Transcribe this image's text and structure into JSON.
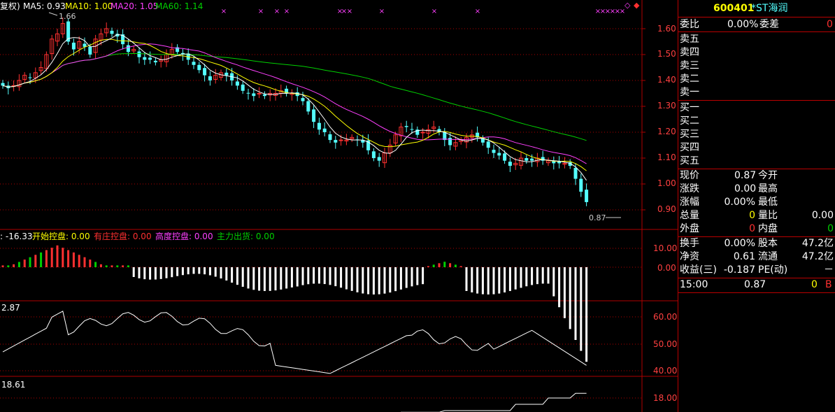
{
  "header": {
    "prefix": "复权)",
    "ma5": "MA5: 0.93",
    "ma10": "MA10: 1.00",
    "ma20": "MA20: 1.05",
    "ma60": "MA60: 1.14",
    "high_marker": "1.66",
    "low_marker": "0.87"
  },
  "ind1": {
    "prefix": ": -16.33",
    "items": [
      "开始控盘: 0.00",
      "有庄控盘: 0.00",
      "高度控盘: 0.00",
      "主力出货: 0.00"
    ]
  },
  "ind2": {
    "value": "2.87"
  },
  "ind3": {
    "value": "18.61"
  },
  "axes": {
    "price": [
      "1.60",
      "1.50",
      "1.40",
      "1.30",
      "1.20",
      "1.10",
      "1.00",
      "0.90"
    ],
    "ind1": [
      "10.00",
      "0.00"
    ],
    "ind2": [
      "60.00",
      "50.00",
      "40.00"
    ],
    "ind3": [
      "18.00"
    ]
  },
  "colors": {
    "up": "#ff3030",
    "down": "#54ffff",
    "ma5": "#ffffff",
    "ma10": "#ffff00",
    "ma20": "#ff40ff",
    "ma60": "#00d000",
    "grid": "#b00000"
  },
  "quote": {
    "code": "600401",
    "name": "*ST海润",
    "weibi_label": "委比",
    "weibi_value": "0.00%",
    "weicha_label": "委差",
    "weicha_value": "0",
    "sell": [
      "卖五",
      "卖四",
      "卖三",
      "卖二",
      "卖一"
    ],
    "buy": [
      "买一",
      "买二",
      "买三",
      "买四",
      "买五"
    ],
    "stats": [
      {
        "l1": "现价",
        "v1": "0.87",
        "l2": "今开",
        "v2": ""
      },
      {
        "l1": "涨跌",
        "v1": "0.00",
        "l2": "最高",
        "v2": ""
      },
      {
        "l1": "涨幅",
        "v1": "0.00%",
        "l2": "最低",
        "v2": ""
      },
      {
        "l1": "总量",
        "v1": "0",
        "l2": "量比",
        "v2": "0.00"
      },
      {
        "l1": "外盘",
        "v1": "0",
        "l2": "内盘",
        "v2": "0"
      }
    ],
    "fund": [
      {
        "l1": "换手",
        "v1": "0.00%",
        "l2": "股本",
        "v2": "47.2亿"
      },
      {
        "l1": "净资",
        "v1": "0.61",
        "l2": "流通",
        "v2": "47.2亿"
      },
      {
        "l1": "收益(三)",
        "v1": "-0.187",
        "l2": "PE(动)",
        "v2": "－"
      }
    ],
    "tick": {
      "time": "15:00",
      "price": "0.87",
      "vol": "0",
      "side": "B"
    }
  },
  "chart_data": {
    "type": "candlestick",
    "ylim": [
      0.85,
      1.66
    ],
    "closes": [
      1.38,
      1.37,
      1.38,
      1.4,
      1.42,
      1.41,
      1.43,
      1.45,
      1.5,
      1.56,
      1.58,
      1.62,
      1.55,
      1.52,
      1.55,
      1.53,
      1.5,
      1.56,
      1.58,
      1.6,
      1.58,
      1.57,
      1.54,
      1.51,
      1.52,
      1.49,
      1.48,
      1.48,
      1.47,
      1.48,
      1.5,
      1.52,
      1.51,
      1.5,
      1.48,
      1.46,
      1.44,
      1.42,
      1.4,
      1.42,
      1.43,
      1.42,
      1.4,
      1.38,
      1.36,
      1.35,
      1.34,
      1.35,
      1.34,
      1.35,
      1.35,
      1.36,
      1.35,
      1.35,
      1.34,
      1.32,
      1.28,
      1.24,
      1.21,
      1.2,
      1.17,
      1.16,
      1.17,
      1.17,
      1.18,
      1.17,
      1.16,
      1.13,
      1.1,
      1.09,
      1.12,
      1.15,
      1.19,
      1.22,
      1.22,
      1.21,
      1.19,
      1.2,
      1.21,
      1.22,
      1.2,
      1.17,
      1.15,
      1.16,
      1.17,
      1.18,
      1.19,
      1.18,
      1.16,
      1.14,
      1.12,
      1.11,
      1.09,
      1.07,
      1.08,
      1.1,
      1.09,
      1.09,
      1.1,
      1.09,
      1.09,
      1.08,
      1.08,
      1.08,
      1.07,
      1.02,
      0.97,
      0.93
    ]
  }
}
